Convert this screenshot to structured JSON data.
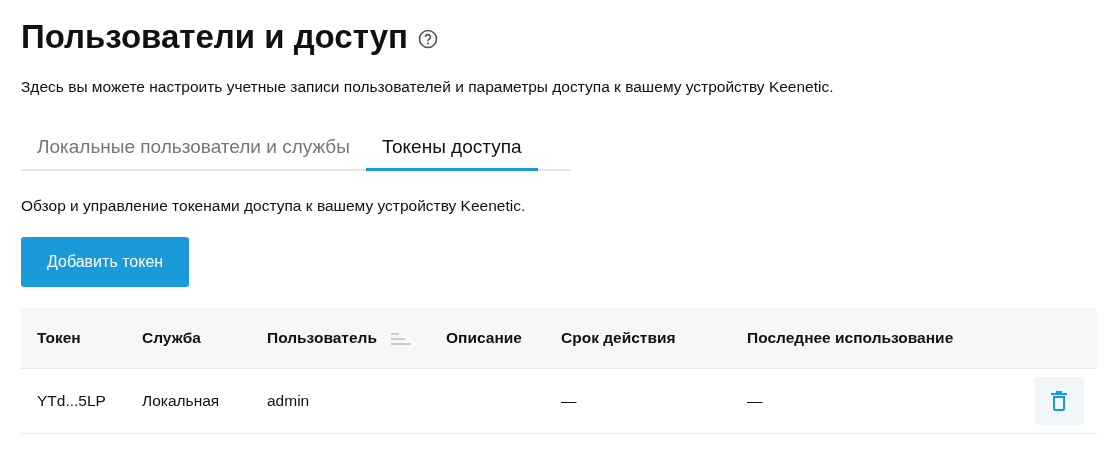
{
  "page": {
    "title": "Пользователи и доступ",
    "description": "Здесь вы можете настроить учетные записи пользователей и параметры доступа к вашему устройству Keenetic."
  },
  "tabs": [
    {
      "label": "Локальные пользователи и службы",
      "selected": false
    },
    {
      "label": "Токены доступа",
      "selected": true
    }
  ],
  "section": {
    "description": "Обзор и управление токенами доступа к вашему устройству Keenetic.",
    "add_button": "Добавить токен"
  },
  "table": {
    "columns": [
      {
        "label": "Токен",
        "sortable": false
      },
      {
        "label": "Служба",
        "sortable": false
      },
      {
        "label": "Пользователь",
        "sortable": true
      },
      {
        "label": "Описание",
        "sortable": false
      },
      {
        "label": "Срок действия",
        "sortable": false
      },
      {
        "label": "Последнее использование",
        "sortable": false
      }
    ],
    "rows": [
      {
        "cells": [
          "YTd...5LP",
          "Локальная",
          "admin",
          "",
          "—",
          "—"
        ]
      }
    ]
  }
}
